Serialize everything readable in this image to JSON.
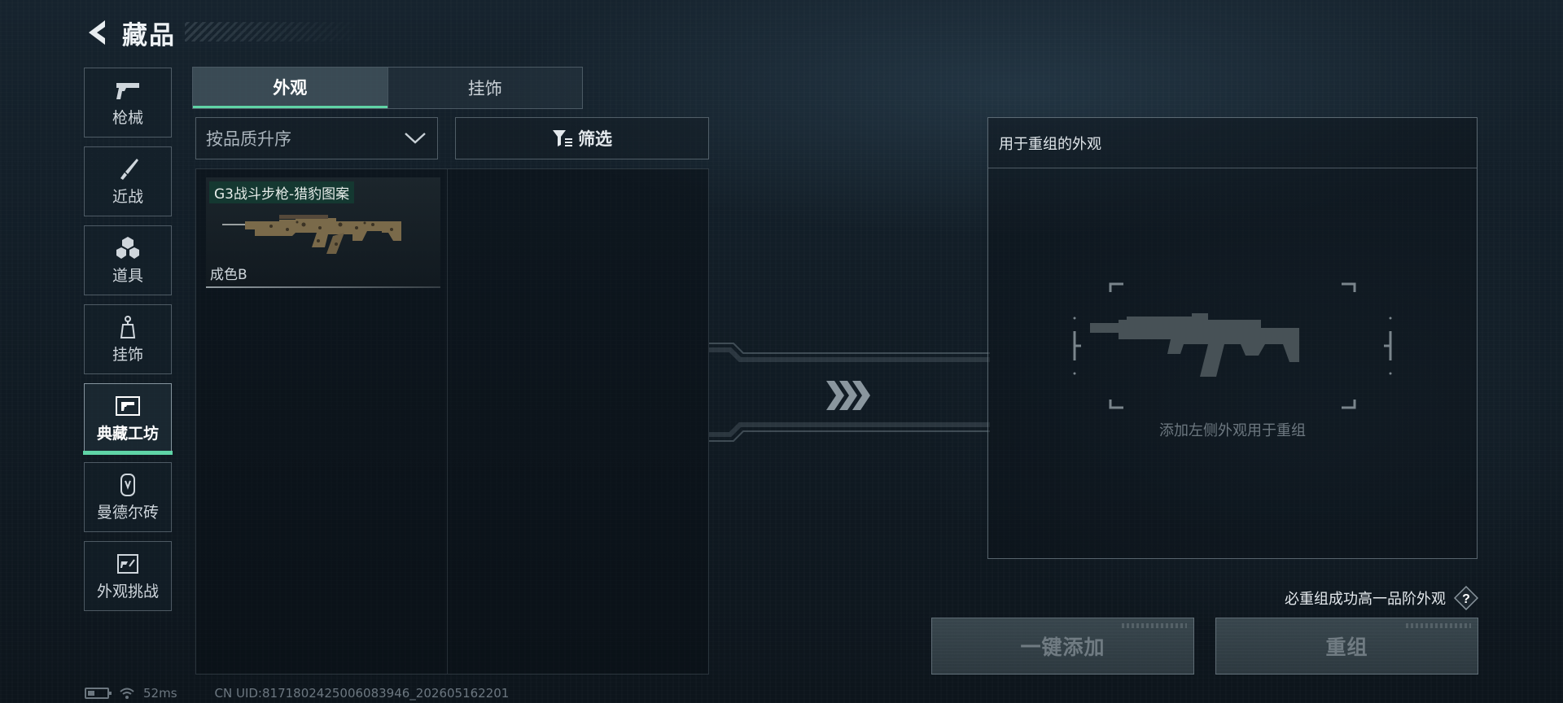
{
  "header": {
    "title": "藏品"
  },
  "sidebar": {
    "items": [
      {
        "label": "枪械",
        "icon": "pistol-icon",
        "active": false
      },
      {
        "label": "近战",
        "icon": "knife-icon",
        "active": false
      },
      {
        "label": "道具",
        "icon": "grenades-icon",
        "active": false
      },
      {
        "label": "挂饰",
        "icon": "charm-icon",
        "active": false
      },
      {
        "label": "典藏工坊",
        "icon": "workshop-frame-icon",
        "active": true
      },
      {
        "label": "曼德尔砖",
        "icon": "brick-icon",
        "active": false
      },
      {
        "label": "外观挑战",
        "icon": "challenge-icon",
        "active": false
      }
    ]
  },
  "tabs": [
    {
      "label": "外观",
      "active": true
    },
    {
      "label": "挂饰",
      "active": false
    }
  ],
  "sort": {
    "value": "按品质升序"
  },
  "filter": {
    "label": "筛选"
  },
  "items": [
    {
      "name": "G3战斗步枪-猎豹图案",
      "grade": "成色B"
    }
  ],
  "recombine": {
    "title": "用于重组的外观",
    "empty_hint": "添加左侧外观用于重组",
    "guarantee_text": "必重组成功高一品阶外观",
    "help_label": "?",
    "add_all_label": "一键添加",
    "recombine_label": "重组"
  },
  "status": {
    "ping": "52ms",
    "uid": "CN UID:8171802425006083946_202605162201"
  },
  "colors": {
    "accent": "#5fd4a6",
    "background": "#111c25"
  }
}
